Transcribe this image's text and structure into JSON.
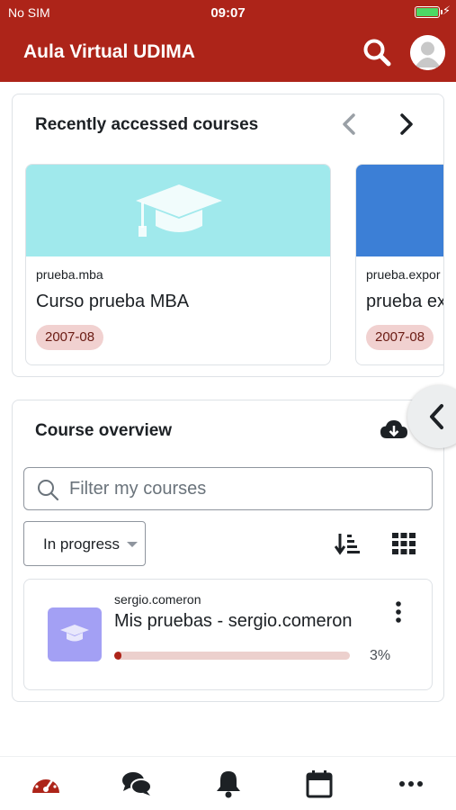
{
  "status_bar": {
    "carrier": "No SIM",
    "time": "09:07"
  },
  "header": {
    "title": "Aula Virtual UDIMA"
  },
  "recent": {
    "title": "Recently accessed courses",
    "courses": [
      {
        "shortname": "prueba.mba",
        "name": "Curso prueba MBA",
        "badge": "2007-08",
        "image_color": "#a0e9ec"
      },
      {
        "shortname": "prueba.expor",
        "name": "prueba ex",
        "badge": "2007-08",
        "image_color": "#3c7fd6"
      }
    ]
  },
  "overview": {
    "title": "Course overview",
    "search_placeholder": "Filter my courses",
    "filter_value": "In progress",
    "courses": [
      {
        "shortname": "sergio.comeron",
        "name": "Mis pruebas - sergio.comeron",
        "progress_label": "3%",
        "progress": 3
      }
    ]
  },
  "colors": {
    "brand": "#ad2419",
    "badge_bg": "#f1d1d0",
    "thumb": "#a3a0f4"
  },
  "tabbar": {
    "icons": [
      "dashboard-icon",
      "messages-icon",
      "notifications-icon",
      "calendar-icon",
      "more-icon"
    ]
  }
}
